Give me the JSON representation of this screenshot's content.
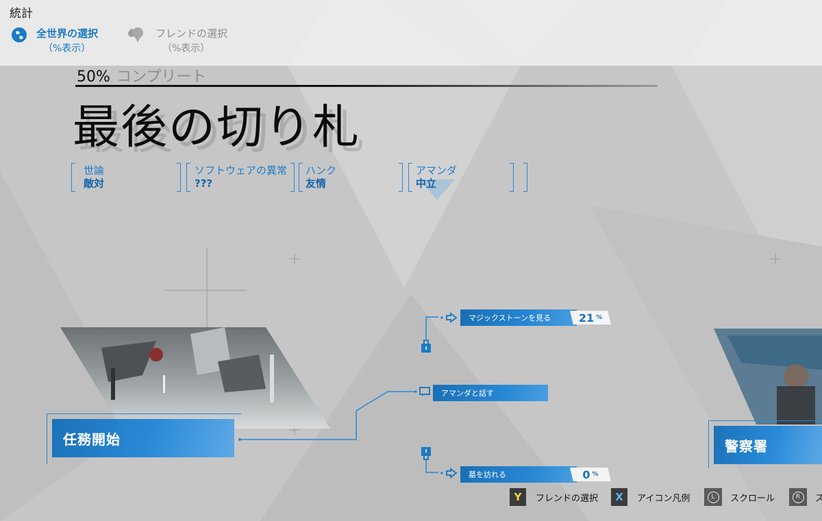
{
  "header": {
    "title": "統計",
    "modes": [
      {
        "label": "全世界の選択",
        "sub": "（%表示）",
        "icon": "globe-icon",
        "active": true
      },
      {
        "label": "フレンドの選択",
        "sub": "（%表示）",
        "icon": "friends-icon",
        "active": false
      }
    ]
  },
  "chapter": {
    "completion_value": "50%",
    "completion_label": "コンプリート",
    "title": "最後の切り札"
  },
  "relationships": [
    {
      "name": "世論",
      "value": "敵対"
    },
    {
      "name": "ソフトウェアの異常",
      "value": "???"
    },
    {
      "name": "ハンク",
      "value": "友情"
    },
    {
      "name": "アマンダ",
      "value": "中立"
    }
  ],
  "flowchart": {
    "start_node": {
      "label": "任務開始"
    },
    "end_node": {
      "label": "警察署"
    },
    "choices": [
      {
        "label": "マジックストーンを見る",
        "percent": "21",
        "unit": "%"
      },
      {
        "label": "アマンダと話す",
        "percent": "",
        "unit": ""
      },
      {
        "label": "墓を訪れる",
        "percent": "0",
        "unit": "%"
      }
    ]
  },
  "controls": [
    {
      "button": "Y",
      "label": "フレンドの選択"
    },
    {
      "button": "X",
      "label": "アイコン凡例"
    },
    {
      "button": "L",
      "label": "スクロール"
    },
    {
      "button": "R",
      "label": "ス"
    }
  ],
  "colors": {
    "accent": "#1d7ac4",
    "node_blue": "#2a8ad8",
    "background": "#c9c9c9",
    "button_y": "#f1d64c",
    "button_x": "#5ab4f0"
  }
}
